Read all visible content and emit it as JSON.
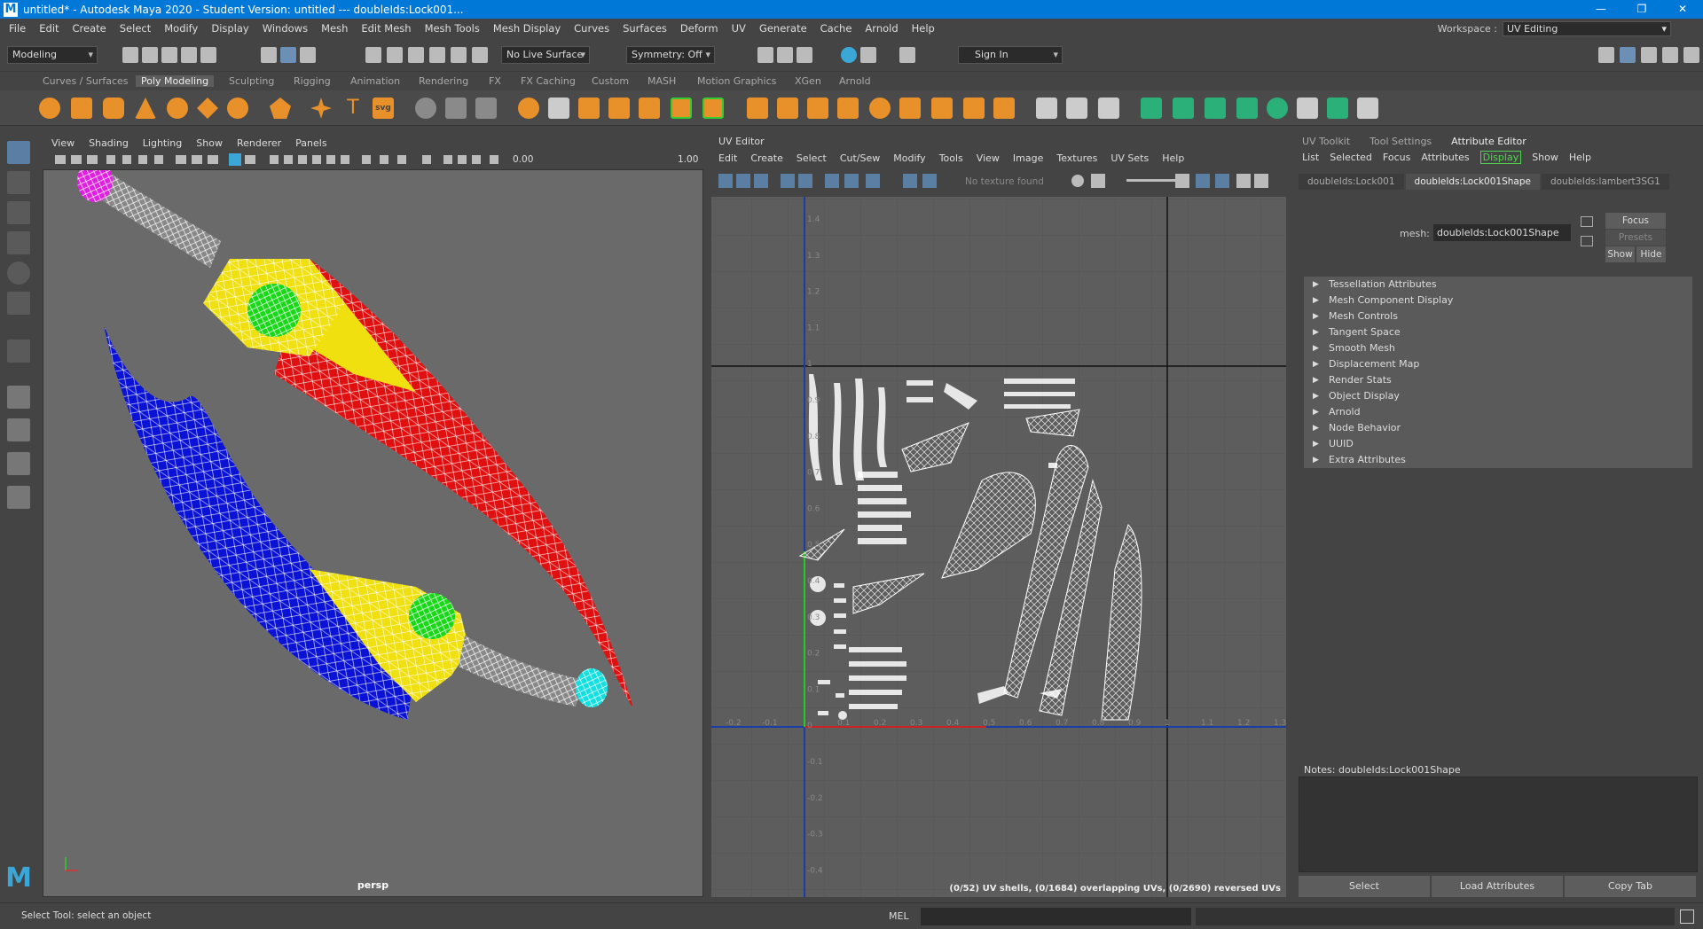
{
  "app": {
    "title": "untitled* - Autodesk Maya 2020 - Student Version: untitled   ---   doubleIds:Lock001..."
  },
  "window_controls": {
    "minimize": "—",
    "restore": "❐",
    "close": "✕"
  },
  "main_menu": [
    "File",
    "Edit",
    "Create",
    "Select",
    "Modify",
    "Display",
    "Windows",
    "Mesh",
    "Edit Mesh",
    "Mesh Tools",
    "Mesh Display",
    "Curves",
    "Surfaces",
    "Deform",
    "UV",
    "Generate",
    "Cache",
    "Arnold",
    "Help"
  ],
  "workspace": {
    "label": "Workspace :",
    "value": "UV Editing"
  },
  "statusline": {
    "mode": "Modeling",
    "live_surface": "No Live Surface",
    "symmetry": "Symmetry: Off",
    "sign_in": "Sign In"
  },
  "shelf_tabs": [
    "Curves / Surfaces",
    "Poly Modeling",
    "Sculpting",
    "Rigging",
    "Animation",
    "Rendering",
    "FX",
    "FX Caching",
    "Custom",
    "MASH",
    "Motion Graphics",
    "XGen",
    "Arnold"
  ],
  "shelf_active": "Poly Modeling",
  "viewport": {
    "menu": [
      "View",
      "Shading",
      "Lighting",
      "Show",
      "Renderer",
      "Panels"
    ],
    "field1": "0.00",
    "field2": "1.00",
    "camera_label": "persp",
    "colors": {
      "red": "#e01010",
      "blue": "#0a12d6",
      "yellow": "#f0e010",
      "green": "#18d818",
      "magenta": "#e020e0",
      "cyan": "#10e0e0"
    }
  },
  "uv_editor": {
    "title": "UV Editor",
    "menu": [
      "Edit",
      "Create",
      "Select",
      "Cut/Sew",
      "Modify",
      "Tools",
      "View",
      "Image",
      "Textures",
      "UV Sets",
      "Help"
    ],
    "texture_status": "No texture found",
    "stats": "(0/52) UV shells, (0/1684) overlapping UVs, (0/2690) reversed UVs",
    "v_ticks": [
      "1.4",
      "1.3",
      "1.2",
      "1.1",
      "1",
      "0.9",
      "0.8",
      "0.7",
      "0.6",
      "0.5",
      "0.4",
      "0.3",
      "0.2",
      "0.1",
      "0",
      "-0.1",
      "-0.2",
      "-0.3",
      "-0.4"
    ],
    "u_ticks": [
      "-0.2",
      "-0.1",
      "0.1",
      "0.2",
      "0.3",
      "0.4",
      "0.5",
      "0.6",
      "0.7",
      "0.8",
      "0.9",
      "1",
      "1.1",
      "1.2",
      "1.3"
    ]
  },
  "attribute_editor": {
    "top_tabs": [
      "UV Toolkit",
      "Tool Settings",
      "Attribute Editor"
    ],
    "active_top_tab": "Attribute Editor",
    "menu": [
      "List",
      "Selected",
      "Focus",
      "Attributes",
      "Display",
      "Show",
      "Help"
    ],
    "node_tabs": [
      "doubleIds:Lock001",
      "doubleIds:Lock001Shape",
      "doubleIds:lambert3SG1"
    ],
    "mesh_label": "mesh:",
    "mesh_value": "doubleIds:Lock001Shape",
    "focus": "Focus",
    "presets": "Presets",
    "show": "Show",
    "hide": "Hide",
    "sections": [
      "Tessellation Attributes",
      "Mesh Component Display",
      "Mesh Controls",
      "Tangent Space",
      "Smooth Mesh",
      "Displacement Map",
      "Render Stats",
      "Object Display",
      "Arnold",
      "Node Behavior",
      "UUID",
      "Extra Attributes"
    ],
    "notes_label": "Notes:  doubleIds:Lock001Shape",
    "buttons": [
      "Select",
      "Load Attributes",
      "Copy Tab"
    ]
  },
  "helpline": {
    "help": "Select Tool: select an object",
    "lang": "MEL"
  }
}
